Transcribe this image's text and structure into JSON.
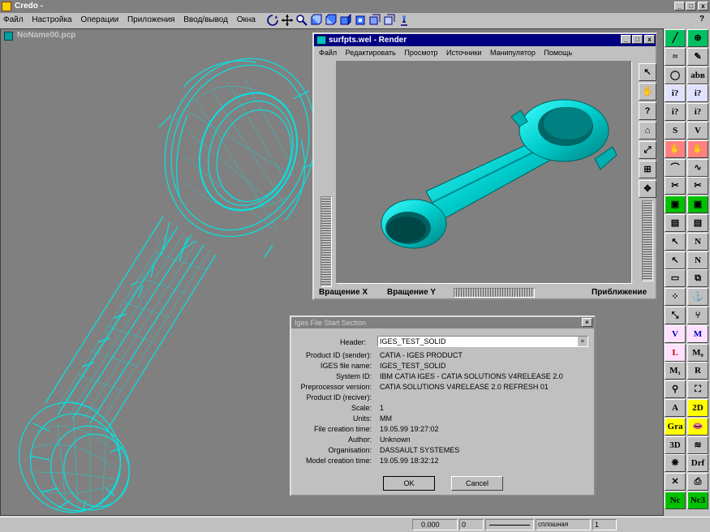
{
  "app": {
    "title": "Credo -",
    "menu": [
      "Файл",
      "Настройка",
      "Операции",
      "Приложения",
      "Ввод/вывод",
      "Окна"
    ],
    "help_mark": "?"
  },
  "doc_window": {
    "title": "NoName00.pcp",
    "wire_color": "#00e5e5"
  },
  "render_window": {
    "title": "surfpts.wel - Render",
    "menu": [
      "Файл",
      "Редактировать",
      "Просмотр",
      "Источники",
      "Манипулятор",
      "Помощь"
    ],
    "rotate_x_label": "Вращение X",
    "rotate_y_label": "Вращение Y",
    "zoom_label": "Приближение",
    "solid_color": "#00cccc",
    "tool_glyphs": [
      "↖",
      "✋",
      "?",
      "⌂",
      "⤢",
      "⊞",
      "✥"
    ]
  },
  "iges_dialog": {
    "title": "Iges File Start Section",
    "close_glyph": "×",
    "header_label": "Header:",
    "header_value": "IGES_TEST_SOLID",
    "fields": [
      {
        "label": "Product ID (sender):",
        "value": "CATIA - IGES PRODUCT"
      },
      {
        "label": "IGES file name:",
        "value": "IGES_TEST_SOLID"
      },
      {
        "label": "System ID:",
        "value": "IBM CATIA IGES - CATIA SOLUTIONS V4RELEASE 2.0"
      },
      {
        "label": "Preprocessor version:",
        "value": "CATIA SOLUTIONS V4RELEASE 2.0 REFRESH 01"
      },
      {
        "label": "Product ID (reciver):",
        "value": ""
      },
      {
        "label": "Scale:",
        "value": "1"
      },
      {
        "label": "Units:",
        "value": "MM"
      },
      {
        "label": "File creation time:",
        "value": "19.05.99 19:27:02"
      },
      {
        "label": "Author:",
        "value": "Unknown"
      },
      {
        "label": "Organisation:",
        "value": "DASSAULT SYSTEMES"
      },
      {
        "label": "Model creation time:",
        "value": "19.05.99 18:32:12"
      }
    ],
    "ok_label": "OK",
    "cancel_label": "Cancel"
  },
  "status_bar": {
    "coord_value": "0.000",
    "field2_value": "0",
    "combo_value": "сплошная",
    "page_value": "1"
  },
  "palette": {
    "labels": [
      "аbв",
      "i?",
      "i?",
      "i?",
      "i?",
      "S",
      "V",
      "N",
      "N",
      "V",
      "M",
      "L",
      "M₀",
      "M₁",
      "R",
      "A",
      "2D",
      "Gra",
      "3D",
      "Drf",
      "Nc",
      "Nc3"
    ],
    "accent_yellow": "#ffff00",
    "accent_green": "#00c000",
    "accent_red": "#ff8080"
  }
}
